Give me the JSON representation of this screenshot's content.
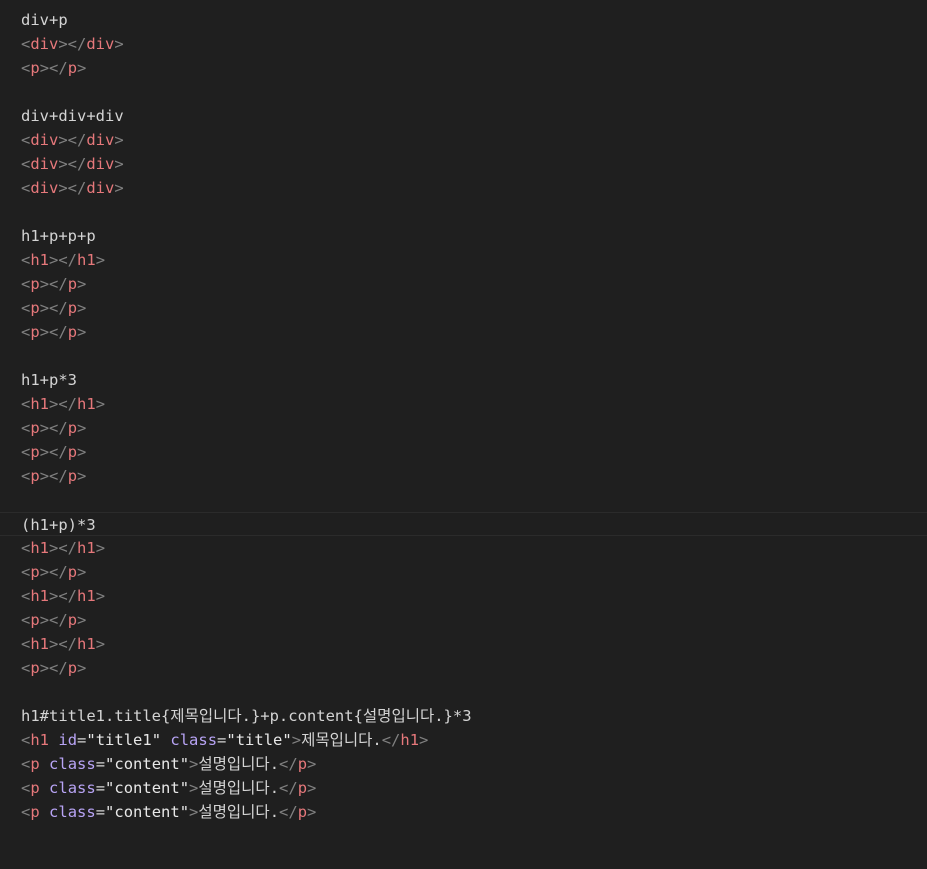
{
  "colors": {
    "background": "#1f1f1f",
    "text": "#d4d4d4",
    "punctuation": "#808080",
    "tag": "#e6787b",
    "attribute": "#b8a4f5",
    "string": "#e8e8e8"
  },
  "editor": {
    "current_line": 21,
    "lines": [
      [
        {
          "k": "text",
          "v": "div+p"
        }
      ],
      [
        {
          "k": "punct",
          "v": "<"
        },
        {
          "k": "tag",
          "v": "div"
        },
        {
          "k": "punct",
          "v": "></"
        },
        {
          "k": "tag",
          "v": "div"
        },
        {
          "k": "punct",
          "v": ">"
        }
      ],
      [
        {
          "k": "punct",
          "v": "<"
        },
        {
          "k": "tag",
          "v": "p"
        },
        {
          "k": "punct",
          "v": "></"
        },
        {
          "k": "tag",
          "v": "p"
        },
        {
          "k": "punct",
          "v": ">"
        }
      ],
      [],
      [
        {
          "k": "text",
          "v": "div+div+div"
        }
      ],
      [
        {
          "k": "punct",
          "v": "<"
        },
        {
          "k": "tag",
          "v": "div"
        },
        {
          "k": "punct",
          "v": "></"
        },
        {
          "k": "tag",
          "v": "div"
        },
        {
          "k": "punct",
          "v": ">"
        }
      ],
      [
        {
          "k": "punct",
          "v": "<"
        },
        {
          "k": "tag",
          "v": "div"
        },
        {
          "k": "punct",
          "v": "></"
        },
        {
          "k": "tag",
          "v": "div"
        },
        {
          "k": "punct",
          "v": ">"
        }
      ],
      [
        {
          "k": "punct",
          "v": "<"
        },
        {
          "k": "tag",
          "v": "div"
        },
        {
          "k": "punct",
          "v": "></"
        },
        {
          "k": "tag",
          "v": "div"
        },
        {
          "k": "punct",
          "v": ">"
        }
      ],
      [],
      [
        {
          "k": "text",
          "v": "h1+p+p+p"
        }
      ],
      [
        {
          "k": "punct",
          "v": "<"
        },
        {
          "k": "tag",
          "v": "h1"
        },
        {
          "k": "punct",
          "v": "></"
        },
        {
          "k": "tag",
          "v": "h1"
        },
        {
          "k": "punct",
          "v": ">"
        }
      ],
      [
        {
          "k": "punct",
          "v": "<"
        },
        {
          "k": "tag",
          "v": "p"
        },
        {
          "k": "punct",
          "v": "></"
        },
        {
          "k": "tag",
          "v": "p"
        },
        {
          "k": "punct",
          "v": ">"
        }
      ],
      [
        {
          "k": "punct",
          "v": "<"
        },
        {
          "k": "tag",
          "v": "p"
        },
        {
          "k": "punct",
          "v": "></"
        },
        {
          "k": "tag",
          "v": "p"
        },
        {
          "k": "punct",
          "v": ">"
        }
      ],
      [
        {
          "k": "punct",
          "v": "<"
        },
        {
          "k": "tag",
          "v": "p"
        },
        {
          "k": "punct",
          "v": "></"
        },
        {
          "k": "tag",
          "v": "p"
        },
        {
          "k": "punct",
          "v": ">"
        }
      ],
      [],
      [
        {
          "k": "text",
          "v": "h1+p*3"
        }
      ],
      [
        {
          "k": "punct",
          "v": "<"
        },
        {
          "k": "tag",
          "v": "h1"
        },
        {
          "k": "punct",
          "v": "></"
        },
        {
          "k": "tag",
          "v": "h1"
        },
        {
          "k": "punct",
          "v": ">"
        }
      ],
      [
        {
          "k": "punct",
          "v": "<"
        },
        {
          "k": "tag",
          "v": "p"
        },
        {
          "k": "punct",
          "v": "></"
        },
        {
          "k": "tag",
          "v": "p"
        },
        {
          "k": "punct",
          "v": ">"
        }
      ],
      [
        {
          "k": "punct",
          "v": "<"
        },
        {
          "k": "tag",
          "v": "p"
        },
        {
          "k": "punct",
          "v": "></"
        },
        {
          "k": "tag",
          "v": "p"
        },
        {
          "k": "punct",
          "v": ">"
        }
      ],
      [
        {
          "k": "punct",
          "v": "<"
        },
        {
          "k": "tag",
          "v": "p"
        },
        {
          "k": "punct",
          "v": "></"
        },
        {
          "k": "tag",
          "v": "p"
        },
        {
          "k": "punct",
          "v": ">"
        }
      ],
      [],
      [
        {
          "k": "text",
          "v": "(h1+p)*3"
        }
      ],
      [
        {
          "k": "punct",
          "v": "<"
        },
        {
          "k": "tag",
          "v": "h1"
        },
        {
          "k": "punct",
          "v": "></"
        },
        {
          "k": "tag",
          "v": "h1"
        },
        {
          "k": "punct",
          "v": ">"
        }
      ],
      [
        {
          "k": "punct",
          "v": "<"
        },
        {
          "k": "tag",
          "v": "p"
        },
        {
          "k": "punct",
          "v": "></"
        },
        {
          "k": "tag",
          "v": "p"
        },
        {
          "k": "punct",
          "v": ">"
        }
      ],
      [
        {
          "k": "punct",
          "v": "<"
        },
        {
          "k": "tag",
          "v": "h1"
        },
        {
          "k": "punct",
          "v": "></"
        },
        {
          "k": "tag",
          "v": "h1"
        },
        {
          "k": "punct",
          "v": ">"
        }
      ],
      [
        {
          "k": "punct",
          "v": "<"
        },
        {
          "k": "tag",
          "v": "p"
        },
        {
          "k": "punct",
          "v": "></"
        },
        {
          "k": "tag",
          "v": "p"
        },
        {
          "k": "punct",
          "v": ">"
        }
      ],
      [
        {
          "k": "punct",
          "v": "<"
        },
        {
          "k": "tag",
          "v": "h1"
        },
        {
          "k": "punct",
          "v": "></"
        },
        {
          "k": "tag",
          "v": "h1"
        },
        {
          "k": "punct",
          "v": ">"
        }
      ],
      [
        {
          "k": "punct",
          "v": "<"
        },
        {
          "k": "tag",
          "v": "p"
        },
        {
          "k": "punct",
          "v": "></"
        },
        {
          "k": "tag",
          "v": "p"
        },
        {
          "k": "punct",
          "v": ">"
        }
      ],
      [],
      [
        {
          "k": "text",
          "v": "h1#title1.title{제목입니다.}+p.content{설명입니다.}*3"
        }
      ],
      [
        {
          "k": "punct",
          "v": "<"
        },
        {
          "k": "tag",
          "v": "h1"
        },
        {
          "k": "text",
          "v": " "
        },
        {
          "k": "attr",
          "v": "id"
        },
        {
          "k": "eq",
          "v": "="
        },
        {
          "k": "str",
          "v": "\"title1\""
        },
        {
          "k": "text",
          "v": " "
        },
        {
          "k": "attr",
          "v": "class"
        },
        {
          "k": "eq",
          "v": "="
        },
        {
          "k": "str",
          "v": "\"title\""
        },
        {
          "k": "punct",
          "v": ">"
        },
        {
          "k": "text",
          "v": "제목입니다."
        },
        {
          "k": "punct",
          "v": "</"
        },
        {
          "k": "tag",
          "v": "h1"
        },
        {
          "k": "punct",
          "v": ">"
        }
      ],
      [
        {
          "k": "punct",
          "v": "<"
        },
        {
          "k": "tag",
          "v": "p"
        },
        {
          "k": "text",
          "v": " "
        },
        {
          "k": "attr",
          "v": "class"
        },
        {
          "k": "eq",
          "v": "="
        },
        {
          "k": "str",
          "v": "\"content\""
        },
        {
          "k": "punct",
          "v": ">"
        },
        {
          "k": "text",
          "v": "설명입니다."
        },
        {
          "k": "punct",
          "v": "</"
        },
        {
          "k": "tag",
          "v": "p"
        },
        {
          "k": "punct",
          "v": ">"
        }
      ],
      [
        {
          "k": "punct",
          "v": "<"
        },
        {
          "k": "tag",
          "v": "p"
        },
        {
          "k": "text",
          "v": " "
        },
        {
          "k": "attr",
          "v": "class"
        },
        {
          "k": "eq",
          "v": "="
        },
        {
          "k": "str",
          "v": "\"content\""
        },
        {
          "k": "punct",
          "v": ">"
        },
        {
          "k": "text",
          "v": "설명입니다."
        },
        {
          "k": "punct",
          "v": "</"
        },
        {
          "k": "tag",
          "v": "p"
        },
        {
          "k": "punct",
          "v": ">"
        }
      ],
      [
        {
          "k": "punct",
          "v": "<"
        },
        {
          "k": "tag",
          "v": "p"
        },
        {
          "k": "text",
          "v": " "
        },
        {
          "k": "attr",
          "v": "class"
        },
        {
          "k": "eq",
          "v": "="
        },
        {
          "k": "str",
          "v": "\"content\""
        },
        {
          "k": "punct",
          "v": ">"
        },
        {
          "k": "text",
          "v": "설명입니다."
        },
        {
          "k": "punct",
          "v": "</"
        },
        {
          "k": "tag",
          "v": "p"
        },
        {
          "k": "punct",
          "v": ">"
        }
      ]
    ]
  }
}
